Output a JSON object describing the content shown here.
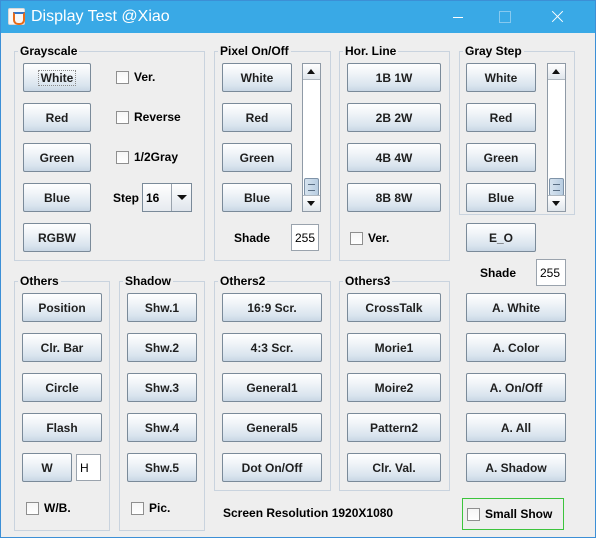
{
  "window": {
    "title": "Display Test @Xiao"
  },
  "grayscale": {
    "title": "Grayscale",
    "buttons": [
      "White",
      "Red",
      "Green",
      "Blue",
      "RGBW"
    ],
    "checkboxes": [
      "Ver.",
      "Reverse",
      "1/2Gray"
    ],
    "step_label": "Step",
    "step_value": "16"
  },
  "pixel": {
    "title": "Pixel On/Off",
    "buttons": [
      "White",
      "Red",
      "Green",
      "Blue"
    ],
    "shade_label": "Shade",
    "shade_value": "255"
  },
  "hline": {
    "title": "Hor. Line",
    "buttons": [
      "1B 1W",
      "2B 2W",
      "4B 4W",
      "8B 8W"
    ],
    "ver_label": "Ver."
  },
  "graystep": {
    "title": "Gray Step",
    "buttons": [
      "White",
      "Red",
      "Green",
      "Blue",
      "E_O"
    ],
    "shade_label": "Shade",
    "shade_value": "255",
    "action_buttons": [
      "A. White",
      "A. Color",
      "A. On/Off",
      "A. All",
      "A. Shadow"
    ]
  },
  "others": {
    "title": "Others",
    "buttons": [
      "Position",
      "Clr. Bar",
      "Circle",
      "Flash"
    ],
    "w_button": "W",
    "h_value": "H",
    "wb_label": "W/B."
  },
  "shadow": {
    "title": "Shadow",
    "buttons": [
      "Shw.1",
      "Shw.2",
      "Shw.3",
      "Shw.4",
      "Shw.5"
    ],
    "pic_label": "Pic."
  },
  "others2": {
    "title": "Others2",
    "buttons": [
      "16:9 Scr.",
      "4:3 Scr.",
      "General1",
      "General5",
      "Dot On/Off"
    ]
  },
  "others3": {
    "title": "Others3",
    "buttons": [
      "CrossTalk",
      "Morie1",
      "Moire2",
      "Pattern2",
      "Clr. Val."
    ]
  },
  "footer": {
    "resolution": "Screen Resolution 1920X1080",
    "small_show": "Small Show"
  },
  "colors": {
    "titlebar": "#39a9e6",
    "small_show_border": "#3cc43c"
  }
}
